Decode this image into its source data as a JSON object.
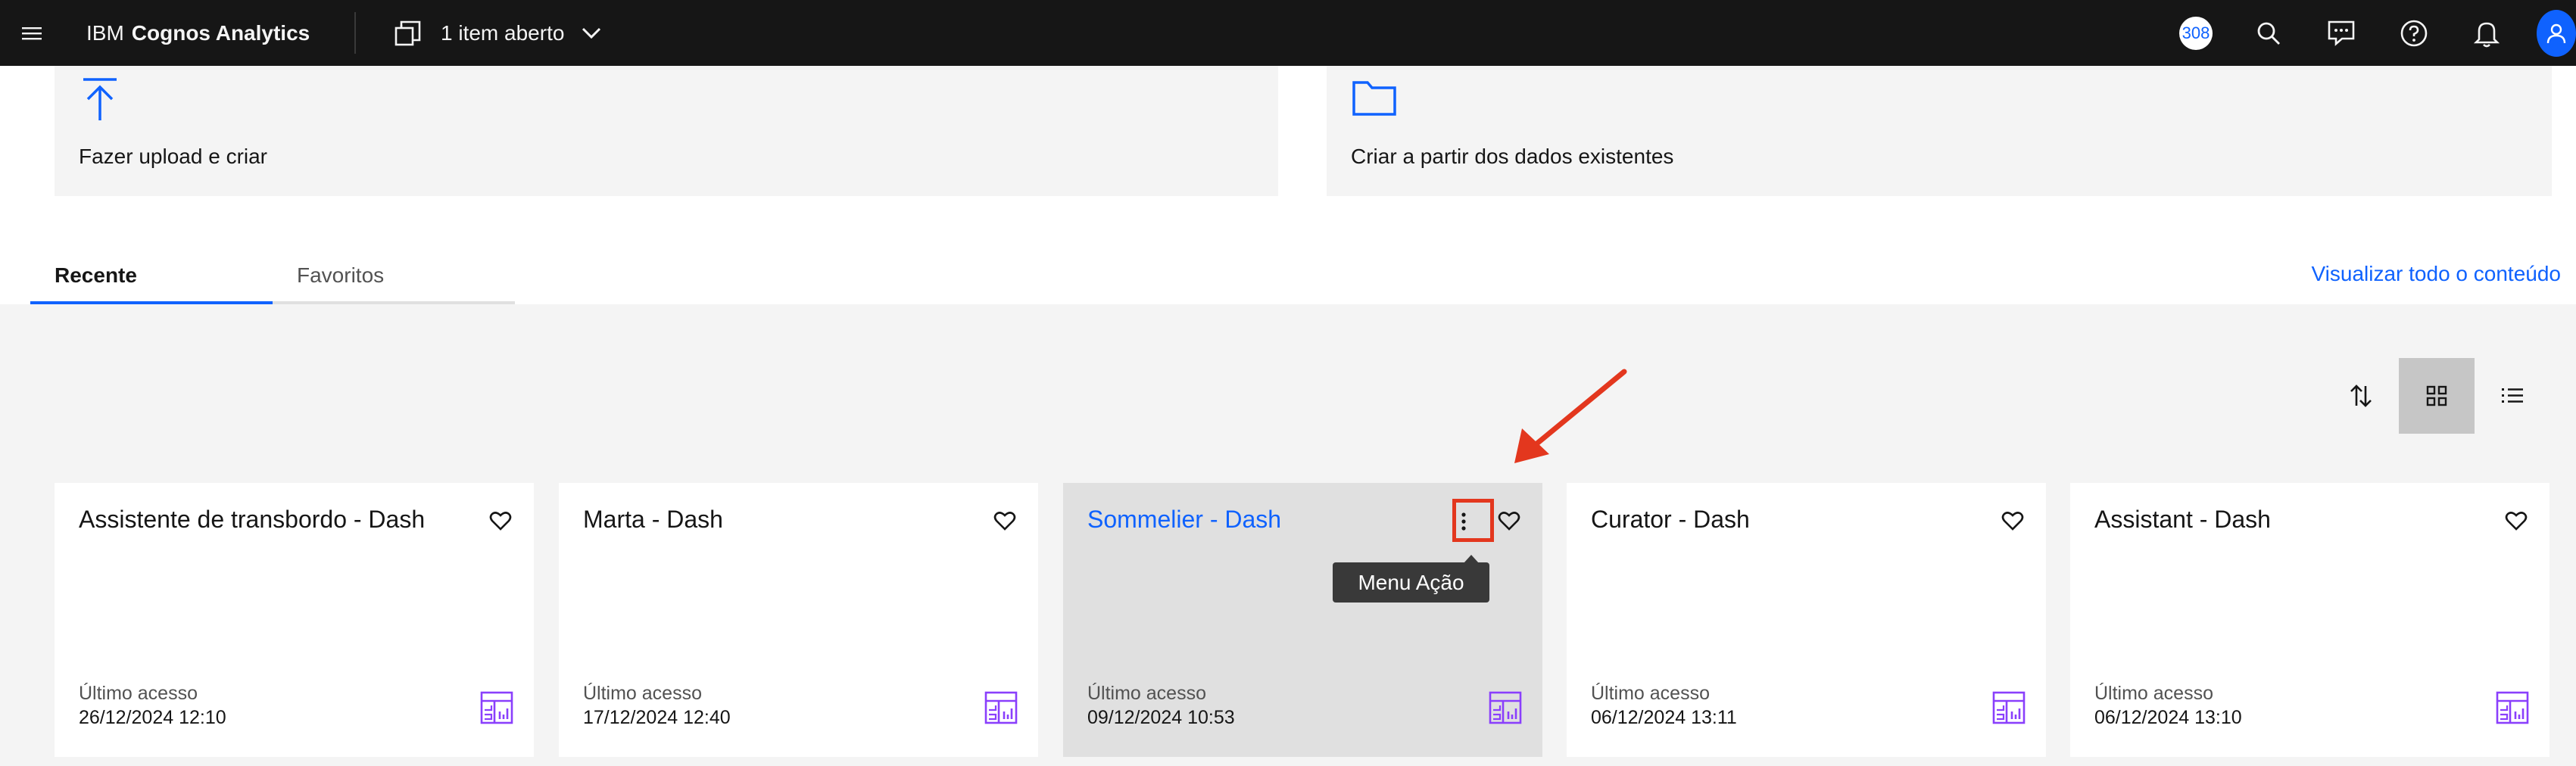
{
  "header": {
    "brand_prefix": "IBM",
    "brand_product": "Cognos Analytics",
    "open_items_label": "1 item aberto",
    "counter_value": "308"
  },
  "create_tiles": [
    {
      "label": "Fazer upload e criar",
      "icon": "upload-icon"
    },
    {
      "label": "Criar a partir dos dados existentes",
      "icon": "folder-icon"
    }
  ],
  "tabs": [
    {
      "label": "Recente",
      "active": true
    },
    {
      "label": "Favoritos",
      "active": false
    }
  ],
  "view_all_label": "Visualizar todo o conteúdo",
  "cards": [
    {
      "title": "Assistente de transbordo - Dash",
      "access_label": "Último acesso",
      "access_date": "26/12/2024 12:10"
    },
    {
      "title": "Marta - Dash",
      "access_label": "Último acesso",
      "access_date": "17/12/2024 12:40"
    },
    {
      "title": "Sommelier - Dash",
      "access_label": "Último acesso",
      "access_date": "09/12/2024 10:53"
    },
    {
      "title": "Curator - Dash",
      "access_label": "Último acesso",
      "access_date": "06/12/2024 13:11"
    },
    {
      "title": "Assistant - Dash",
      "access_label": "Último acesso",
      "access_date": "06/12/2024 13:10"
    }
  ],
  "tooltip": {
    "label": "Menu Ação"
  },
  "colors": {
    "header_bg": "#161616",
    "accent": "#0f62fe",
    "dashboard_icon": "#8a3ffc",
    "annotation": "#e3371e"
  }
}
